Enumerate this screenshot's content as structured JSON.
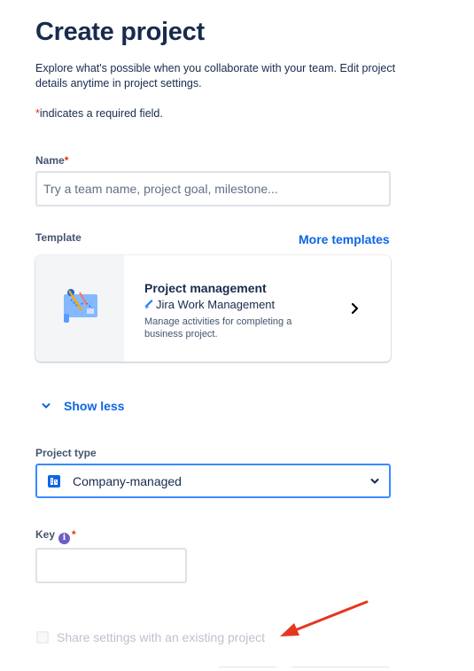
{
  "page": {
    "title": "Create project",
    "description": "Explore what's possible when you collaborate with your team. Edit project details anytime in project settings.",
    "required_marker": "*",
    "required_note": "indicates a required field."
  },
  "name_field": {
    "label": "Name",
    "required_marker": "*",
    "value": "",
    "placeholder": "Try a team name, project goal, milestone..."
  },
  "template": {
    "label": "Template",
    "more_link": "More templates",
    "card": {
      "name": "Project management",
      "product": "Jira Work Management",
      "description": "Manage activities for completing a business project."
    }
  },
  "toggle": {
    "label": "Show less"
  },
  "project_type": {
    "label": "Project type",
    "value": "Company-managed"
  },
  "key_field": {
    "label": "Key",
    "info_glyph": "i",
    "required_marker": "*",
    "value": ""
  },
  "share_settings": {
    "label": "Share settings with an existing project",
    "checked": false,
    "disabled": true
  },
  "colors": {
    "link": "#0c66e4",
    "required": "#de350b",
    "focus_border": "#388bff",
    "annotation_arrow": "#e5371f",
    "info_icon": "#6e5dc6"
  },
  "icons": {
    "template_thumb": "blueprint-illustration-icon",
    "product": "jira-work-management-logo-icon",
    "card_chevron": "chevron-right-icon",
    "toggle": "chevron-down-icon",
    "select_icon": "company-building-icon",
    "select_chevron": "chevron-down-icon",
    "info": "info-icon"
  }
}
